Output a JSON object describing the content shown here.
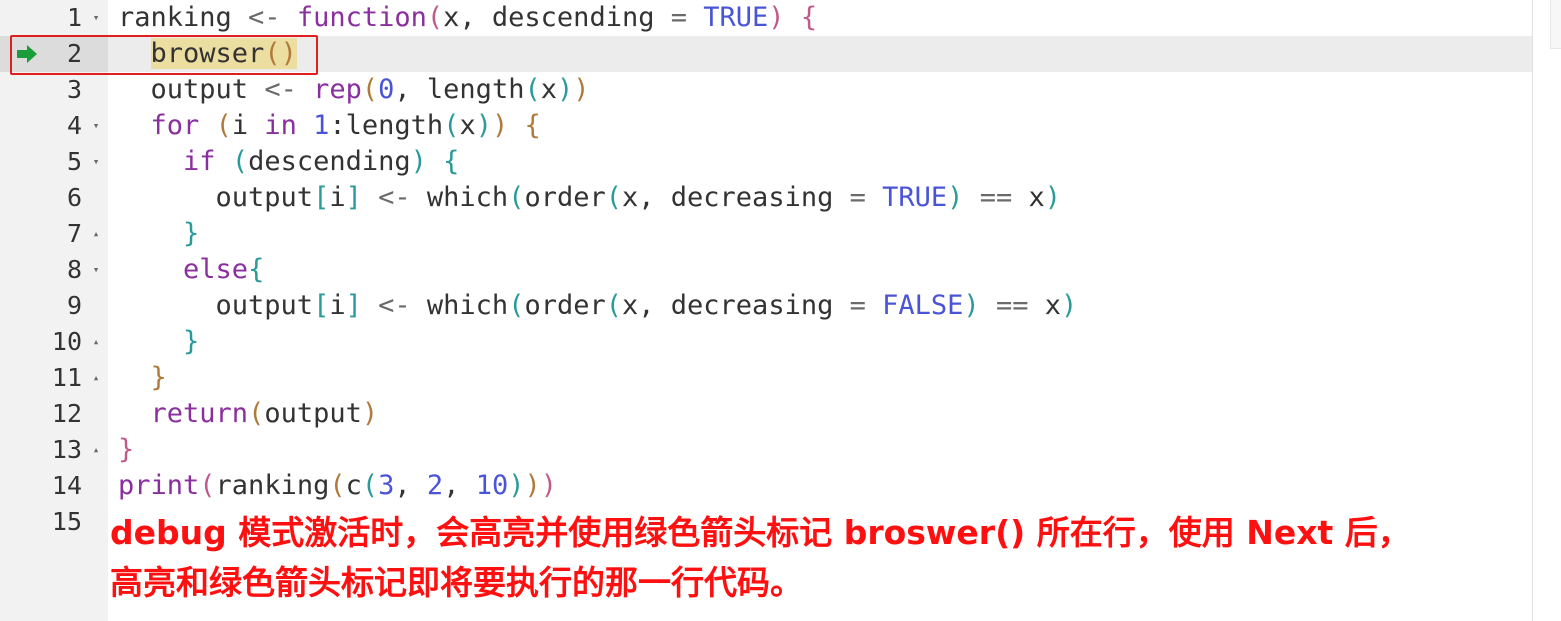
{
  "editor": {
    "lines": [
      {
        "number": "1",
        "fold": "down",
        "tokens": [
          {
            "t": "ranking ",
            "c": "fn"
          },
          {
            "t": "<-",
            "c": "op"
          },
          {
            "t": " ",
            "c": "fn"
          },
          {
            "t": "function",
            "c": "kw"
          },
          {
            "t": "(",
            "c": "paren1"
          },
          {
            "t": "x, descending ",
            "c": "fn"
          },
          {
            "t": "=",
            "c": "op"
          },
          {
            "t": " ",
            "c": "fn"
          },
          {
            "t": "TRUE",
            "c": "const"
          },
          {
            "t": ")",
            "c": "paren1"
          },
          {
            "t": " ",
            "c": "fn"
          },
          {
            "t": "{",
            "c": "paren1"
          }
        ]
      },
      {
        "number": "2",
        "fold": "",
        "active": true,
        "tokens": [
          {
            "t": "  ",
            "c": "fn"
          },
          {
            "t": "browser",
            "c": "hl"
          },
          {
            "t": "()",
            "c": "paren2hl"
          }
        ]
      },
      {
        "number": "3",
        "fold": "",
        "tokens": [
          {
            "t": "  output ",
            "c": "fn"
          },
          {
            "t": "<-",
            "c": "op"
          },
          {
            "t": " ",
            "c": "fn"
          },
          {
            "t": "rep",
            "c": "kw"
          },
          {
            "t": "(",
            "c": "paren2"
          },
          {
            "t": "0",
            "c": "num"
          },
          {
            "t": ", length",
            "c": "fn"
          },
          {
            "t": "(",
            "c": "paren3"
          },
          {
            "t": "x",
            "c": "fn"
          },
          {
            "t": ")",
            "c": "paren3"
          },
          {
            "t": ")",
            "c": "paren2"
          }
        ]
      },
      {
        "number": "4",
        "fold": "down",
        "tokens": [
          {
            "t": "  ",
            "c": "fn"
          },
          {
            "t": "for",
            "c": "kw"
          },
          {
            "t": " ",
            "c": "fn"
          },
          {
            "t": "(",
            "c": "paren2"
          },
          {
            "t": "i ",
            "c": "fn"
          },
          {
            "t": "in",
            "c": "kw"
          },
          {
            "t": " ",
            "c": "fn"
          },
          {
            "t": "1",
            "c": "num"
          },
          {
            "t": ":length",
            "c": "fn"
          },
          {
            "t": "(",
            "c": "paren3"
          },
          {
            "t": "x",
            "c": "fn"
          },
          {
            "t": ")",
            "c": "paren3"
          },
          {
            "t": ")",
            "c": "paren2"
          },
          {
            "t": " ",
            "c": "fn"
          },
          {
            "t": "{",
            "c": "paren2"
          }
        ]
      },
      {
        "number": "5",
        "fold": "down",
        "tokens": [
          {
            "t": "    ",
            "c": "fn"
          },
          {
            "t": "if",
            "c": "kw"
          },
          {
            "t": " ",
            "c": "fn"
          },
          {
            "t": "(",
            "c": "paren3"
          },
          {
            "t": "descending",
            "c": "fn"
          },
          {
            "t": ")",
            "c": "paren3"
          },
          {
            "t": " ",
            "c": "fn"
          },
          {
            "t": "{",
            "c": "paren3"
          }
        ]
      },
      {
        "number": "6",
        "fold": "",
        "tokens": [
          {
            "t": "      output",
            "c": "fn"
          },
          {
            "t": "[",
            "c": "paren3"
          },
          {
            "t": "i",
            "c": "fn"
          },
          {
            "t": "]",
            "c": "paren3"
          },
          {
            "t": " ",
            "c": "fn"
          },
          {
            "t": "<-",
            "c": "op"
          },
          {
            "t": " which",
            "c": "fn"
          },
          {
            "t": "(",
            "c": "paren3"
          },
          {
            "t": "order",
            "c": "fn"
          },
          {
            "t": "(",
            "c": "paren3"
          },
          {
            "t": "x, decreasing ",
            "c": "fn"
          },
          {
            "t": "=",
            "c": "op"
          },
          {
            "t": " ",
            "c": "fn"
          },
          {
            "t": "TRUE",
            "c": "const"
          },
          {
            "t": ")",
            "c": "paren3"
          },
          {
            "t": " ",
            "c": "fn"
          },
          {
            "t": "==",
            "c": "op"
          },
          {
            "t": " x",
            "c": "fn"
          },
          {
            "t": ")",
            "c": "paren3"
          }
        ]
      },
      {
        "number": "7",
        "fold": "up",
        "tokens": [
          {
            "t": "    ",
            "c": "fn"
          },
          {
            "t": "}",
            "c": "paren3"
          }
        ]
      },
      {
        "number": "8",
        "fold": "down",
        "tokens": [
          {
            "t": "    ",
            "c": "fn"
          },
          {
            "t": "else",
            "c": "kw"
          },
          {
            "t": "{",
            "c": "paren3"
          }
        ]
      },
      {
        "number": "9",
        "fold": "",
        "tokens": [
          {
            "t": "      output",
            "c": "fn"
          },
          {
            "t": "[",
            "c": "paren3"
          },
          {
            "t": "i",
            "c": "fn"
          },
          {
            "t": "]",
            "c": "paren3"
          },
          {
            "t": " ",
            "c": "fn"
          },
          {
            "t": "<-",
            "c": "op"
          },
          {
            "t": " which",
            "c": "fn"
          },
          {
            "t": "(",
            "c": "paren3"
          },
          {
            "t": "order",
            "c": "fn"
          },
          {
            "t": "(",
            "c": "paren3"
          },
          {
            "t": "x, decreasing ",
            "c": "fn"
          },
          {
            "t": "=",
            "c": "op"
          },
          {
            "t": " ",
            "c": "fn"
          },
          {
            "t": "FALSE",
            "c": "const"
          },
          {
            "t": ")",
            "c": "paren3"
          },
          {
            "t": " ",
            "c": "fn"
          },
          {
            "t": "==",
            "c": "op"
          },
          {
            "t": " x",
            "c": "fn"
          },
          {
            "t": ")",
            "c": "paren3"
          }
        ]
      },
      {
        "number": "10",
        "fold": "up",
        "tokens": [
          {
            "t": "    ",
            "c": "fn"
          },
          {
            "t": "}",
            "c": "paren3"
          }
        ]
      },
      {
        "number": "11",
        "fold": "up",
        "tokens": [
          {
            "t": "  ",
            "c": "fn"
          },
          {
            "t": "}",
            "c": "paren2"
          }
        ]
      },
      {
        "number": "12",
        "fold": "",
        "tokens": [
          {
            "t": "  ",
            "c": "fn"
          },
          {
            "t": "return",
            "c": "kw"
          },
          {
            "t": "(",
            "c": "paren2"
          },
          {
            "t": "output",
            "c": "fn"
          },
          {
            "t": ")",
            "c": "paren2"
          }
        ]
      },
      {
        "number": "13",
        "fold": "up",
        "tokens": [
          {
            "t": "}",
            "c": "paren1"
          }
        ]
      },
      {
        "number": "14",
        "fold": "",
        "tokens": [
          {
            "t": "print",
            "c": "kw"
          },
          {
            "t": "(",
            "c": "paren1"
          },
          {
            "t": "ranking",
            "c": "fn"
          },
          {
            "t": "(",
            "c": "paren2"
          },
          {
            "t": "c",
            "c": "fn"
          },
          {
            "t": "(",
            "c": "paren3"
          },
          {
            "t": "3",
            "c": "num"
          },
          {
            "t": ", ",
            "c": "fn"
          },
          {
            "t": "2",
            "c": "num"
          },
          {
            "t": ", ",
            "c": "fn"
          },
          {
            "t": "10",
            "c": "num"
          },
          {
            "t": ")",
            "c": "paren3"
          },
          {
            "t": ")",
            "c": "paren2"
          },
          {
            "t": ")",
            "c": "paren1"
          }
        ]
      },
      {
        "number": "15",
        "fold": "",
        "tokens": []
      }
    ]
  },
  "annotation": {
    "line1": "debug 模式激活时，会高亮并使用绿色箭头标记 broswer() 所在行，使用 Next 后，",
    "line2": "高亮和绿色箭头标记即将要执行的那一行代码。"
  },
  "icons": {
    "debug_arrow": "right-arrow-icon",
    "fold_down": "fold-down-icon",
    "fold_up": "fold-up-icon"
  },
  "colors": {
    "debug_arrow": "#1a9e3a",
    "annotation": "#ff1010",
    "highlight_box": "#e02020"
  }
}
